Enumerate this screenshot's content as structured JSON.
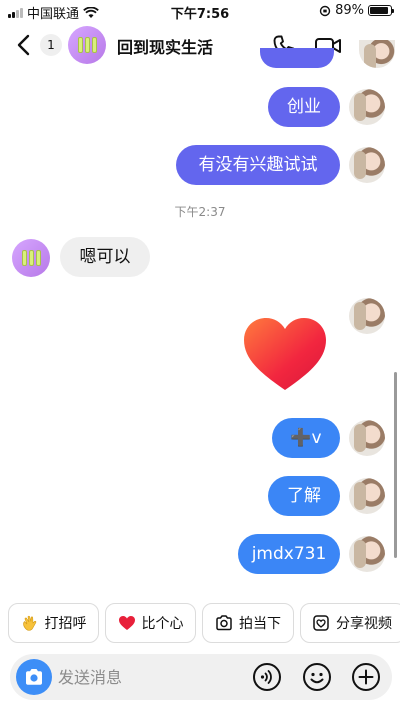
{
  "status_bar": {
    "carrier": "中国联通",
    "time": "下午7:56",
    "battery": "89%",
    "battery_level": 0.89
  },
  "header": {
    "unread_count": "1",
    "title": "回到现实生活",
    "icons": [
      "back-icon",
      "phone-call-icon",
      "video-call-icon",
      "more-icon"
    ]
  },
  "messages": {
    "m1": "创业",
    "m2": "有没有兴趣试试",
    "timestamp": "下午2:37",
    "m3": "嗯可以",
    "m4": "➕v",
    "m5": "了解",
    "m6": "jmdx731"
  },
  "quick_replies": {
    "wave": "打招呼",
    "heart": "比个心",
    "photo": "拍当下",
    "share": "分享视频"
  },
  "composer": {
    "placeholder": "发送消息"
  },
  "colors": {
    "bubble_purple": "#6366ee",
    "bubble_blue": "#3b86f6",
    "bubble_received": "#efefef",
    "accent": "#3d8ef7"
  }
}
